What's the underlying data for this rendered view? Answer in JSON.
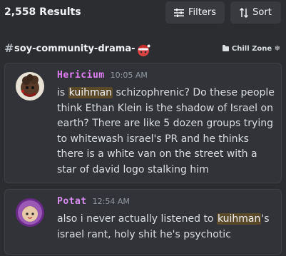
{
  "header": {
    "results_count": "2,558 Results",
    "filters_label": "Filters",
    "sort_label": "Sort"
  },
  "channel": {
    "name": "soy-community-drama-",
    "category": "Chill Zone ❄"
  },
  "messages": [
    {
      "username": "Hericium",
      "timestamp": "10:05 AM",
      "text_before": "is ",
      "highlight": "kuihman",
      "text_after": " schizophrenic? Do these people think Ethan Klein is the shadow of Israel on earth? There are like 5 dozen groups trying to whitewash israel's PR and he thinks there is a white van on the street with a star of david logo stalking him"
    },
    {
      "username": "Potat",
      "timestamp": "12:54 AM",
      "text_before": "also i never actually listened to ",
      "highlight": "kuihman",
      "text_after": "'s israel rant, holy shit he's psychotic"
    }
  ],
  "colors": {
    "background": "#2b2d31",
    "card": "#313338",
    "username1": "#e17ff5",
    "username2": "#d98ef2",
    "highlight": "#5b4a2a"
  },
  "icons": [
    "filters-icon",
    "sort-icon",
    "channel-hash-icon",
    "santa-hat-icon",
    "folder-icon"
  ]
}
